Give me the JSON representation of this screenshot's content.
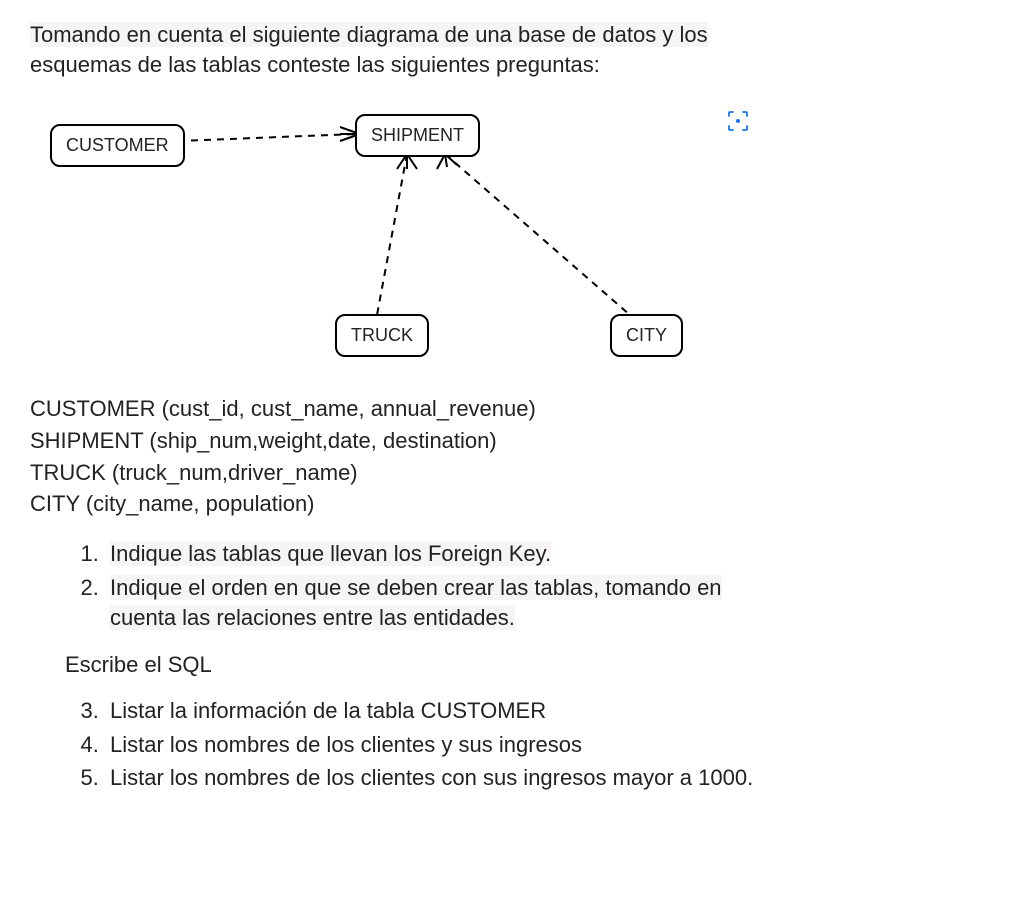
{
  "intro": {
    "line1": "Tomando en cuenta el siguiente diagrama de una base de datos y los",
    "line2_plain": "esquemas de las tablas conteste las siguientes preguntas:"
  },
  "diagram": {
    "entities": {
      "customer": "CUSTOMER",
      "shipment": "SHIPMENT",
      "truck": "TRUCK",
      "city": "CITY"
    }
  },
  "schemas": {
    "customer": "CUSTOMER (cust_id, cust_name, annual_revenue)",
    "shipment": "SHIPMENT (ship_num,weight,date, destination)",
    "truck": "TRUCK (truck_num,driver_name)",
    "city": "CITY (city_name, population)"
  },
  "questions": {
    "q1": "Indique las tablas que llevan los Foreign Key.",
    "q2_line1": "Indique el orden en que se deben crear las tablas, tomando en",
    "q2_line2": "cuenta las relaciones entre las entidades."
  },
  "sql_heading": "Escribe el SQL",
  "sql_questions": {
    "q3": "Listar la información de la tabla CUSTOMER",
    "q4": "Listar los nombres de los clientes y sus ingresos",
    "q5": "Listar los nombres de los clientes con sus ingresos mayor a 1000."
  }
}
